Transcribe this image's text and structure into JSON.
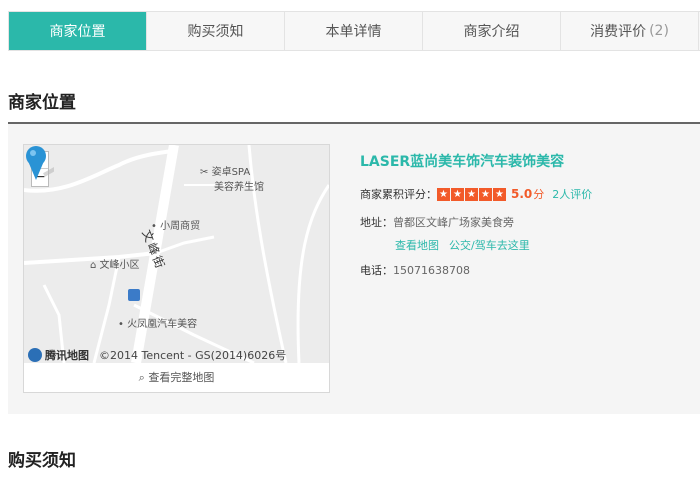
{
  "tabs": [
    {
      "label": "商家位置",
      "active": true
    },
    {
      "label": "购买须知"
    },
    {
      "label": "本单详情"
    },
    {
      "label": "商家介绍"
    },
    {
      "label": "消费评价",
      "count": "(2)"
    }
  ],
  "section_location": {
    "title": "商家位置"
  },
  "map": {
    "zoom_in": "+",
    "zoom_out": "−",
    "poi_spa_1": "姿卓SPA",
    "poi_spa_2": "美容养生馆",
    "poi_mall": "小周商贸",
    "street": "文峰街",
    "poi_community": "文峰小区",
    "poi_car": "火凤凰汽车美容",
    "logo": "腾讯地图",
    "copyright": "©2014 Tencent - GS(2014)6026号",
    "view_full": "查看完整地图"
  },
  "store": {
    "name": "LASER蓝尚美车饰汽车装饰美容",
    "rating_label": "商家累积评分：",
    "rating_score": "5.0",
    "rating_unit": "分",
    "review_count_text": "2人评价",
    "address_label": "地址：",
    "address": "曾都区文峰广场家美食旁",
    "view_map": "查看地图",
    "directions": "公交/驾车去这里",
    "phone_label": "电话：",
    "phone": "15071638708"
  },
  "section_notice": {
    "title": "购买须知"
  },
  "colors": {
    "accent": "#2bb8aa",
    "rating": "#f25a29"
  }
}
